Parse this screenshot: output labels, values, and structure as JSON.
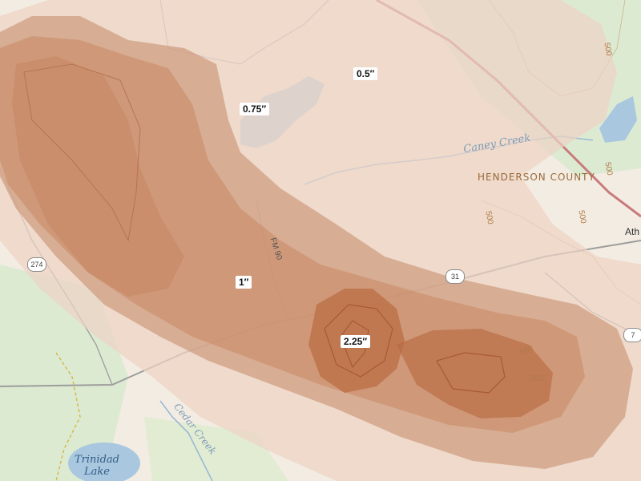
{
  "map": {
    "colors": {
      "background": "#f3ece2",
      "band_050": "#edd2c3",
      "band_075": "#cd9b7e",
      "band_100": "#c88862",
      "band_150": "#c07a55",
      "band_225": "#b96a40",
      "water": "#a9c8e0",
      "road_major": "#c97a7a",
      "forest": "#d9ead0"
    },
    "contour_labels": [
      "0.5″",
      "0.75″",
      "1″",
      "2.25″"
    ],
    "water_labels": {
      "caney_creek": "Caney Creek",
      "cedar_creek": "Cedar Creek",
      "trinidad_lake": "Trinidad\nLake"
    },
    "county_label": "HENDERSON COUNTY",
    "town_label": "Ath",
    "road_labels": {
      "fm90": "FM 90"
    },
    "route_shields": [
      "274",
      "31",
      "7"
    ],
    "elevation_labels": [
      "500",
      "500",
      "500",
      "500",
      "500",
      "500"
    ]
  }
}
